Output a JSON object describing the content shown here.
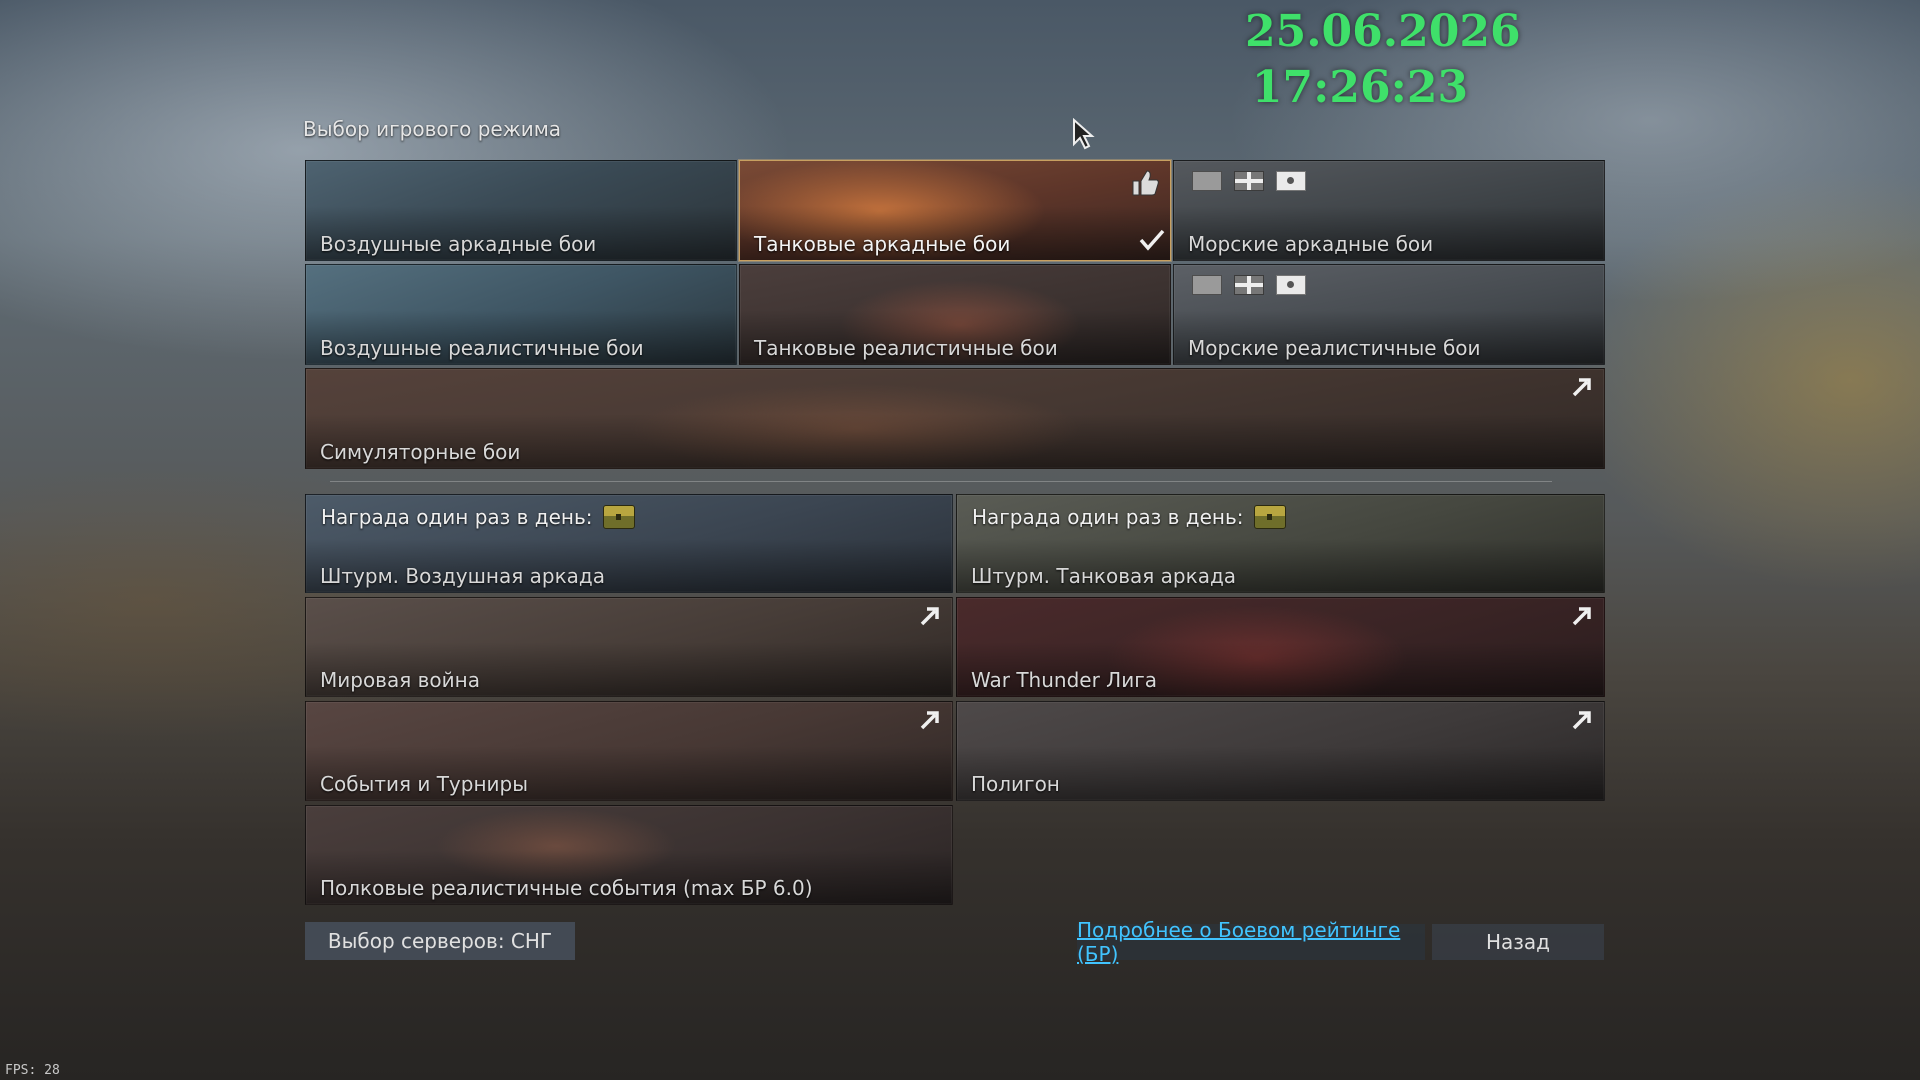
{
  "clock": {
    "date": "25.06.2026",
    "time": "17:26:23",
    "color": "#3fe06a"
  },
  "title": "Выбор игрового режима",
  "modes": {
    "air_arcade": "Воздушные аркадные бои",
    "tank_arcade": "Танковые аркадные бои",
    "naval_arcade": "Морские аркадные бои",
    "air_realistic": "Воздушные реалистичные бои",
    "tank_realistic": "Танковые реалистичные бои",
    "naval_realistic": "Морские реалистичные бои",
    "simulator": "Симуляторные бои"
  },
  "reward_label": "Награда один раз в день:",
  "events": {
    "assault_air": "Штурм. Воздушная аркада",
    "assault_tank": "Штурм. Танковая аркада",
    "world_war": "Мировая война",
    "league": "War Thunder Лига",
    "events_tournaments": "События и Турниры",
    "polygon": "Полигон",
    "regiment": "Полковые реалистичные события (max БР 6.0)"
  },
  "buttons": {
    "servers": "Выбор серверов: СНГ",
    "br_info": "Подробнее о Боевом рейтинге (БР)",
    "back": "Назад"
  },
  "selected_mode": "tank_arcade",
  "fps": "FPS: 28",
  "accent_link": "#41c4ff"
}
